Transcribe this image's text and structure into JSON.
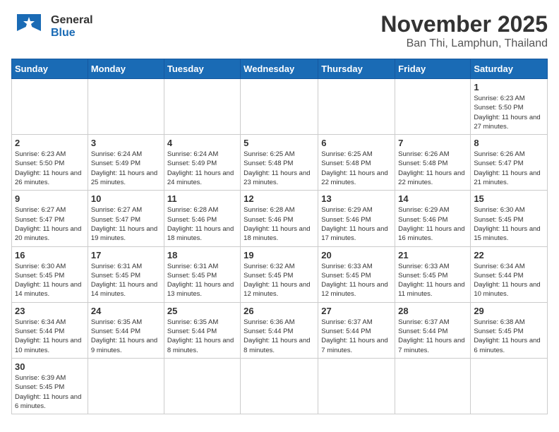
{
  "logo": {
    "general": "General",
    "blue": "Blue"
  },
  "title": "November 2025",
  "location": "Ban Thi, Lamphun, Thailand",
  "days_of_week": [
    "Sunday",
    "Monday",
    "Tuesday",
    "Wednesday",
    "Thursday",
    "Friday",
    "Saturday"
  ],
  "weeks": [
    [
      {
        "day": "",
        "info": ""
      },
      {
        "day": "",
        "info": ""
      },
      {
        "day": "",
        "info": ""
      },
      {
        "day": "",
        "info": ""
      },
      {
        "day": "",
        "info": ""
      },
      {
        "day": "",
        "info": ""
      },
      {
        "day": "1",
        "info": "Sunrise: 6:23 AM\nSunset: 5:50 PM\nDaylight: 11 hours\nand 27 minutes."
      }
    ],
    [
      {
        "day": "2",
        "info": "Sunrise: 6:23 AM\nSunset: 5:50 PM\nDaylight: 11 hours\nand 26 minutes."
      },
      {
        "day": "3",
        "info": "Sunrise: 6:24 AM\nSunset: 5:49 PM\nDaylight: 11 hours\nand 25 minutes."
      },
      {
        "day": "4",
        "info": "Sunrise: 6:24 AM\nSunset: 5:49 PM\nDaylight: 11 hours\nand 24 minutes."
      },
      {
        "day": "5",
        "info": "Sunrise: 6:25 AM\nSunset: 5:48 PM\nDaylight: 11 hours\nand 23 minutes."
      },
      {
        "day": "6",
        "info": "Sunrise: 6:25 AM\nSunset: 5:48 PM\nDaylight: 11 hours\nand 22 minutes."
      },
      {
        "day": "7",
        "info": "Sunrise: 6:26 AM\nSunset: 5:48 PM\nDaylight: 11 hours\nand 22 minutes."
      },
      {
        "day": "8",
        "info": "Sunrise: 6:26 AM\nSunset: 5:47 PM\nDaylight: 11 hours\nand 21 minutes."
      }
    ],
    [
      {
        "day": "9",
        "info": "Sunrise: 6:27 AM\nSunset: 5:47 PM\nDaylight: 11 hours\nand 20 minutes."
      },
      {
        "day": "10",
        "info": "Sunrise: 6:27 AM\nSunset: 5:47 PM\nDaylight: 11 hours\nand 19 minutes."
      },
      {
        "day": "11",
        "info": "Sunrise: 6:28 AM\nSunset: 5:46 PM\nDaylight: 11 hours\nand 18 minutes."
      },
      {
        "day": "12",
        "info": "Sunrise: 6:28 AM\nSunset: 5:46 PM\nDaylight: 11 hours\nand 18 minutes."
      },
      {
        "day": "13",
        "info": "Sunrise: 6:29 AM\nSunset: 5:46 PM\nDaylight: 11 hours\nand 17 minutes."
      },
      {
        "day": "14",
        "info": "Sunrise: 6:29 AM\nSunset: 5:46 PM\nDaylight: 11 hours\nand 16 minutes."
      },
      {
        "day": "15",
        "info": "Sunrise: 6:30 AM\nSunset: 5:45 PM\nDaylight: 11 hours\nand 15 minutes."
      }
    ],
    [
      {
        "day": "16",
        "info": "Sunrise: 6:30 AM\nSunset: 5:45 PM\nDaylight: 11 hours\nand 14 minutes."
      },
      {
        "day": "17",
        "info": "Sunrise: 6:31 AM\nSunset: 5:45 PM\nDaylight: 11 hours\nand 14 minutes."
      },
      {
        "day": "18",
        "info": "Sunrise: 6:31 AM\nSunset: 5:45 PM\nDaylight: 11 hours\nand 13 minutes."
      },
      {
        "day": "19",
        "info": "Sunrise: 6:32 AM\nSunset: 5:45 PM\nDaylight: 11 hours\nand 12 minutes."
      },
      {
        "day": "20",
        "info": "Sunrise: 6:33 AM\nSunset: 5:45 PM\nDaylight: 11 hours\nand 12 minutes."
      },
      {
        "day": "21",
        "info": "Sunrise: 6:33 AM\nSunset: 5:45 PM\nDaylight: 11 hours\nand 11 minutes."
      },
      {
        "day": "22",
        "info": "Sunrise: 6:34 AM\nSunset: 5:44 PM\nDaylight: 11 hours\nand 10 minutes."
      }
    ],
    [
      {
        "day": "23",
        "info": "Sunrise: 6:34 AM\nSunset: 5:44 PM\nDaylight: 11 hours\nand 10 minutes."
      },
      {
        "day": "24",
        "info": "Sunrise: 6:35 AM\nSunset: 5:44 PM\nDaylight: 11 hours\nand 9 minutes."
      },
      {
        "day": "25",
        "info": "Sunrise: 6:35 AM\nSunset: 5:44 PM\nDaylight: 11 hours\nand 8 minutes."
      },
      {
        "day": "26",
        "info": "Sunrise: 6:36 AM\nSunset: 5:44 PM\nDaylight: 11 hours\nand 8 minutes."
      },
      {
        "day": "27",
        "info": "Sunrise: 6:37 AM\nSunset: 5:44 PM\nDaylight: 11 hours\nand 7 minutes."
      },
      {
        "day": "28",
        "info": "Sunrise: 6:37 AM\nSunset: 5:44 PM\nDaylight: 11 hours\nand 7 minutes."
      },
      {
        "day": "29",
        "info": "Sunrise: 6:38 AM\nSunset: 5:45 PM\nDaylight: 11 hours\nand 6 minutes."
      }
    ],
    [
      {
        "day": "30",
        "info": "Sunrise: 6:39 AM\nSunset: 5:45 PM\nDaylight: 11 hours\nand 6 minutes."
      },
      {
        "day": "",
        "info": ""
      },
      {
        "day": "",
        "info": ""
      },
      {
        "day": "",
        "info": ""
      },
      {
        "day": "",
        "info": ""
      },
      {
        "day": "",
        "info": ""
      },
      {
        "day": "",
        "info": ""
      }
    ]
  ]
}
